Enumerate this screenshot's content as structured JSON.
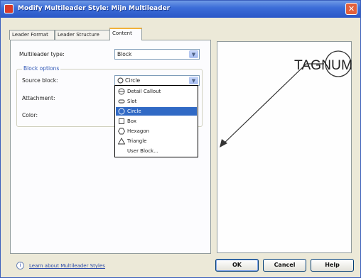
{
  "window": {
    "title": "Modify Multileader Style: Mijn Multileader",
    "close_glyph": "✕"
  },
  "tabs": [
    {
      "label": "Leader Format"
    },
    {
      "label": "Leader Structure"
    },
    {
      "label": "Content"
    }
  ],
  "content": {
    "multileader_type_label": "Multileader type:",
    "multileader_type_value": "Block",
    "block_options_title": "Block options",
    "source_block_label": "Source block:",
    "source_block_value": "Circle",
    "attachment_label": "Attachment:",
    "color_label": "Color:"
  },
  "dropdown": {
    "items": [
      {
        "label": "Detail Callout",
        "icon": "detail-callout-icon"
      },
      {
        "label": "Slot",
        "icon": "slot-icon"
      },
      {
        "label": "Circle",
        "icon": "circle-icon",
        "selected": true
      },
      {
        "label": "Box",
        "icon": "box-icon"
      },
      {
        "label": "Hexagon",
        "icon": "hexagon-icon"
      },
      {
        "label": "Triangle",
        "icon": "triangle-icon"
      },
      {
        "label": "User Block...",
        "icon": ""
      }
    ]
  },
  "preview": {
    "tag_text": "TAGNUM"
  },
  "footer": {
    "help_link": "Learn about Multileader Styles",
    "info_glyph": "i"
  },
  "buttons": {
    "ok": "OK",
    "cancel": "Cancel",
    "help": "Help"
  }
}
